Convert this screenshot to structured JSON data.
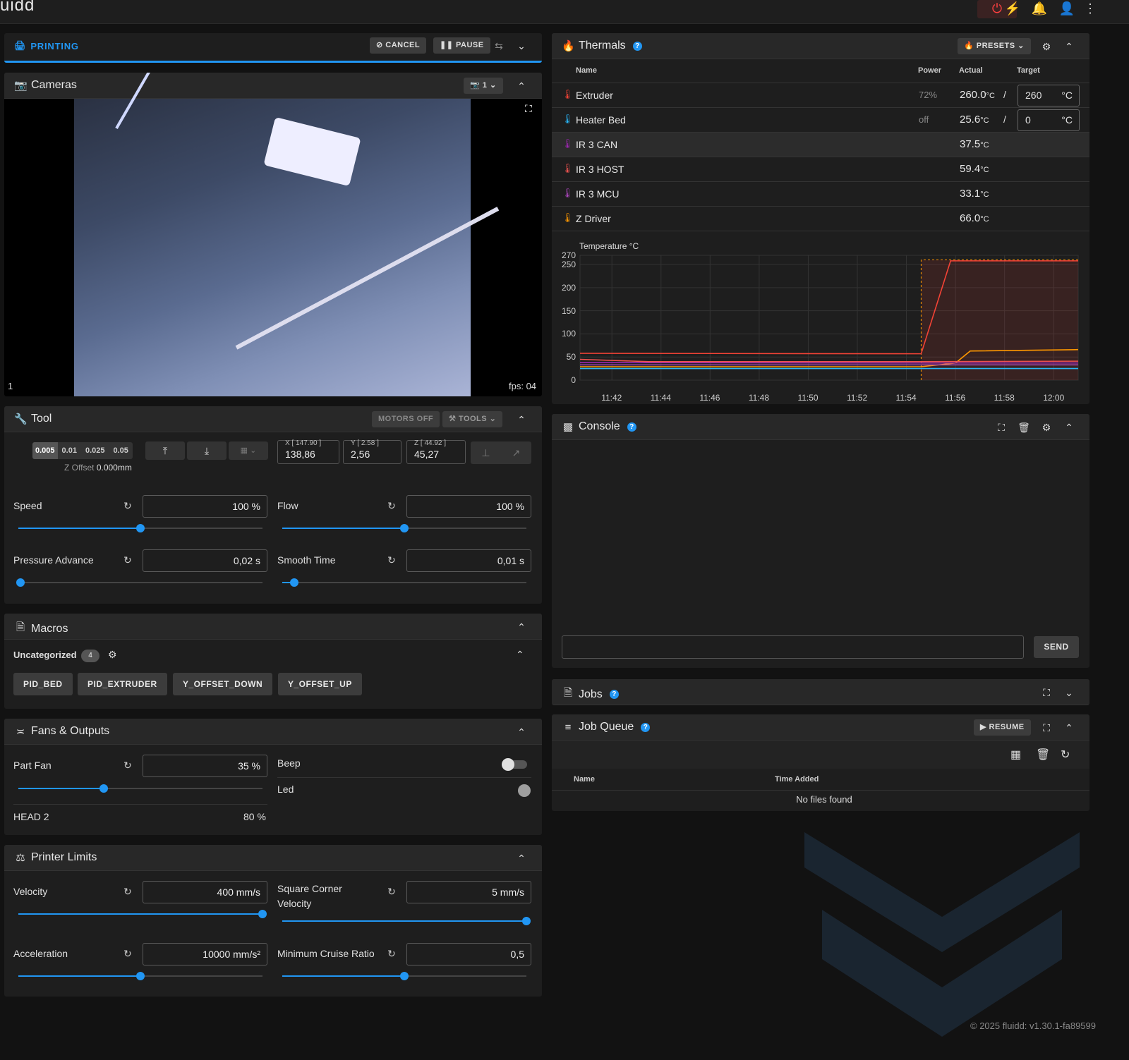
{
  "app": {
    "logo": "uidd"
  },
  "status": {
    "label": "PRINTING",
    "cancel": "CANCEL",
    "pause": "PAUSE"
  },
  "cameras": {
    "title": "Cameras",
    "camera_count": "1",
    "cam_label": "1",
    "fps": "fps: 04"
  },
  "tool": {
    "title": "Tool",
    "motors_off": "MOTORS OFF",
    "tools": "TOOLS",
    "steps": [
      "0.005",
      "0.01",
      "0.025",
      "0.05"
    ],
    "z_offset_label": "Z Offset",
    "z_offset_value": "0.000mm",
    "x_label": "X [ 147.90 ]",
    "x_value": "138,86",
    "y_label": "Y [ 2.58 ]",
    "y_value": "2,56",
    "z_label": "Z [ 44.92 ]",
    "z_value": "45,27",
    "speed_label": "Speed",
    "speed_value": "100 %",
    "speed_pct": 0.5,
    "flow_label": "Flow",
    "flow_value": "100 %",
    "flow_pct": 0.5,
    "pa_label": "Pressure Advance",
    "pa_value": "0,02 s",
    "pa_pct": 0.01,
    "st_label": "Smooth Time",
    "st_value": "0,01 s",
    "st_pct": 0.05
  },
  "macros": {
    "title": "Macros",
    "category": "Uncategorized",
    "count": "4",
    "items": [
      "PID_BED",
      "PID_EXTRUDER",
      "Y_OFFSET_DOWN",
      "Y_OFFSET_UP"
    ]
  },
  "fans": {
    "title": "Fans & Outputs",
    "part_fan_label": "Part Fan",
    "part_fan_value": "35 %",
    "part_fan_pct": 0.35,
    "beep_label": "Beep",
    "led_label": "Led",
    "head2_label": "HEAD 2",
    "head2_value": "80 %"
  },
  "limits": {
    "title": "Printer Limits",
    "velocity_label": "Velocity",
    "velocity_value": "400 mm/s",
    "velocity_pct": 1.0,
    "scv_label_1": "Square Corner",
    "scv_label_2": "Velocity",
    "scv_value": "5 mm/s",
    "scv_pct": 1.0,
    "accel_label": "Acceleration",
    "accel_value": "10000 mm/s²",
    "accel_pct": 0.5,
    "mcr_label": "Minimum Cruise Ratio",
    "mcr_value": "0,5",
    "mcr_pct": 0.5
  },
  "thermals": {
    "title": "Thermals",
    "presets": "PRESETS",
    "headers": {
      "name": "Name",
      "power": "Power",
      "actual": "Actual",
      "target": "Target"
    },
    "rows": [
      {
        "name": "Extruder",
        "power": "72%",
        "actual": "260.0",
        "target": "260",
        "unit": "°C",
        "color": "#f44336"
      },
      {
        "name": "Heater Bed",
        "power": "off",
        "actual": "25.6",
        "target": "0",
        "unit": "°C",
        "color": "#29b6f6"
      },
      {
        "name": "IR 3 CAN",
        "power": "",
        "actual": "37.5",
        "color": "#9c27b0"
      },
      {
        "name": "IR 3 HOST",
        "power": "",
        "actual": "59.4",
        "color": "#ef5350"
      },
      {
        "name": "IR 3 MCU",
        "power": "",
        "actual": "33.1",
        "color": "#ab47bc"
      },
      {
        "name": "Z Driver",
        "power": "",
        "actual": "66.0",
        "color": "#ff9800"
      }
    ],
    "actual_unit": "°C",
    "slash": "/"
  },
  "chart_data": {
    "type": "line",
    "title": "Temperature °C",
    "ylim": [
      0,
      270
    ],
    "yticks": [
      0,
      50,
      100,
      150,
      200,
      250,
      270
    ],
    "x_ticks": [
      "11:42",
      "11:44",
      "11:46",
      "11:48",
      "11:50",
      "11:52",
      "11:54",
      "11:56",
      "11:58",
      "12:00"
    ],
    "x_minutes": [
      0,
      2,
      4,
      6,
      8,
      10,
      12,
      14,
      16,
      18
    ],
    "xlim": [
      -1.3,
      19.0
    ],
    "series": [
      {
        "color": "#f44336",
        "x": [
          -1.3,
          12.6,
          13.8,
          14.6,
          19.0
        ],
        "values": [
          58,
          57,
          258,
          258,
          258
        ]
      },
      {
        "color": "#ff9800",
        "x": [
          -1.3,
          12.6,
          14.0,
          14.6,
          19.0
        ],
        "values": [
          29,
          29,
          37,
          63,
          66
        ]
      },
      {
        "color": "#9c27b0",
        "x": [
          -1.3,
          12.6,
          19.0
        ],
        "values": [
          38,
          37,
          37
        ]
      },
      {
        "color": "#ef5350",
        "x": [
          -1.3,
          1.5,
          12.6,
          19.0
        ],
        "values": [
          45,
          40,
          40,
          41
        ]
      },
      {
        "color": "#ab47bc",
        "x": [
          -1.3,
          12.6,
          19.0
        ],
        "values": [
          33,
          33,
          33
        ]
      },
      {
        "color": "#29b6f6",
        "x": [
          -1.3,
          12.6,
          19.0
        ],
        "values": [
          25,
          25,
          25
        ]
      }
    ],
    "target": {
      "color": "#ff9800",
      "x": [
        12.6,
        19.0
      ],
      "values": [
        260,
        260
      ]
    }
  },
  "console": {
    "title": "Console",
    "send": "SEND"
  },
  "jobs": {
    "title": "Jobs"
  },
  "queue": {
    "title": "Job Queue",
    "resume": "RESUME",
    "col_name": "Name",
    "col_added": "Time Added",
    "empty": "No files found"
  },
  "footer": {
    "text": "© 2025 fluidd: v1.30.1-fa89599"
  }
}
